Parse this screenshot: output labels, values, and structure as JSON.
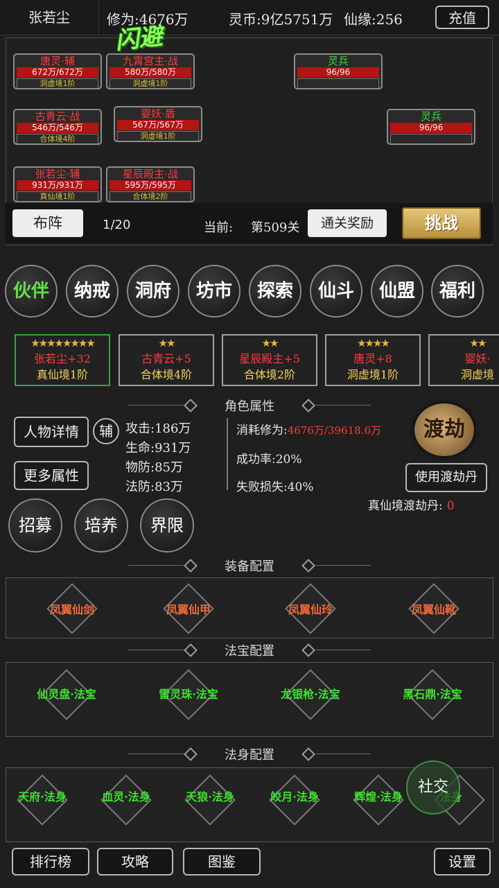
{
  "header": {
    "player_name": "张若尘",
    "cultivation": "修为:4676万",
    "spirit_coin": "灵币:9亿5751万",
    "fate": "仙缘:256",
    "recharge_label": "充值"
  },
  "battle": {
    "dodge_text": "闪避",
    "allies": [
      {
        "name": "唐灵·辅",
        "hp": "672万/672万",
        "realm": "洞虚境1阶"
      },
      {
        "name": "九霄宫主·战",
        "hp": "580万/580万",
        "realm": "洞虚境1阶"
      },
      {
        "name": "古青云·战",
        "hp": "546万/546万",
        "realm": "合体境4阶"
      },
      {
        "name": "婴妖·盾",
        "hp": "567万/567万",
        "realm": "洞虚境1阶"
      },
      {
        "name": "张若尘·辅",
        "hp": "931万/931万",
        "realm": "真仙境1阶"
      },
      {
        "name": "星辰殿主·战",
        "hp": "595万/595万",
        "realm": "合体境2阶"
      }
    ],
    "enemies": [
      {
        "name": "灵兵",
        "hp": "96/96"
      },
      {
        "name": "灵兵",
        "hp": "96/96"
      }
    ],
    "formation_label": "布阵",
    "wave": "1/20",
    "stage_label": "当前:",
    "stage_value": "第509关",
    "clear_reward_label": "通关奖励",
    "challenge_label": "挑战"
  },
  "nav": [
    "伙伴",
    "纳戒",
    "洞府",
    "坊市",
    "探索",
    "仙斗",
    "仙盟",
    "福利"
  ],
  "companions": [
    {
      "stars": "★★★★★★★★",
      "name": "张若尘+32",
      "realm": "真仙境1阶"
    },
    {
      "stars": "★★",
      "name": "古青云+5",
      "realm": "合体境4阶"
    },
    {
      "stars": "★★",
      "name": "星辰殿主+5",
      "realm": "合体境2阶"
    },
    {
      "stars": "★★★★",
      "name": "唐灵+8",
      "realm": "洞虚境1阶"
    },
    {
      "stars": "★★",
      "name": "婴妖·",
      "realm": "洞虚境"
    }
  ],
  "attributes": {
    "title": "角色属性",
    "detail_label": "人物详情",
    "assist_label": "辅",
    "more_label": "更多属性",
    "attack": "攻击:186万",
    "health": "生命:931万",
    "phys_def": "物防:85万",
    "magic_def": "法防:83万",
    "cost_label": "消耗修为:",
    "cost_value": "4676万/39618.6万",
    "success_rate": "成功率:20%",
    "fail_loss": "失败损失:40%",
    "tribulation_emblem": "渡劫",
    "use_pill_label": "使用渡劫丹",
    "pill_count_label": "真仙境渡劫丹:",
    "pill_count": "0",
    "recruit_label": "招募",
    "train_label": "培养",
    "limit_label": "界限"
  },
  "equipment": {
    "title": "装备配置",
    "items": [
      "凤翼仙剑",
      "凤翼仙甲",
      "凤翼仙玲",
      "凤翼仙靴"
    ]
  },
  "treasures": {
    "title": "法宝配置",
    "items": [
      "仙灵盘·法宝",
      "雷灵珠·法宝",
      "龙银枪·法宝",
      "黑石鼎·法宝"
    ]
  },
  "bodies": {
    "title": "法身配置",
    "items": [
      "天府·法身",
      "血灵·法身",
      "天狼·法身",
      "皎月·法身",
      "辉煌·法身",
      "·法身"
    ]
  },
  "social_label": "社交",
  "bottom": {
    "ranking_label": "排行榜",
    "guide_label": "攻略",
    "codex_label": "图鉴",
    "settings_label": "设置"
  }
}
